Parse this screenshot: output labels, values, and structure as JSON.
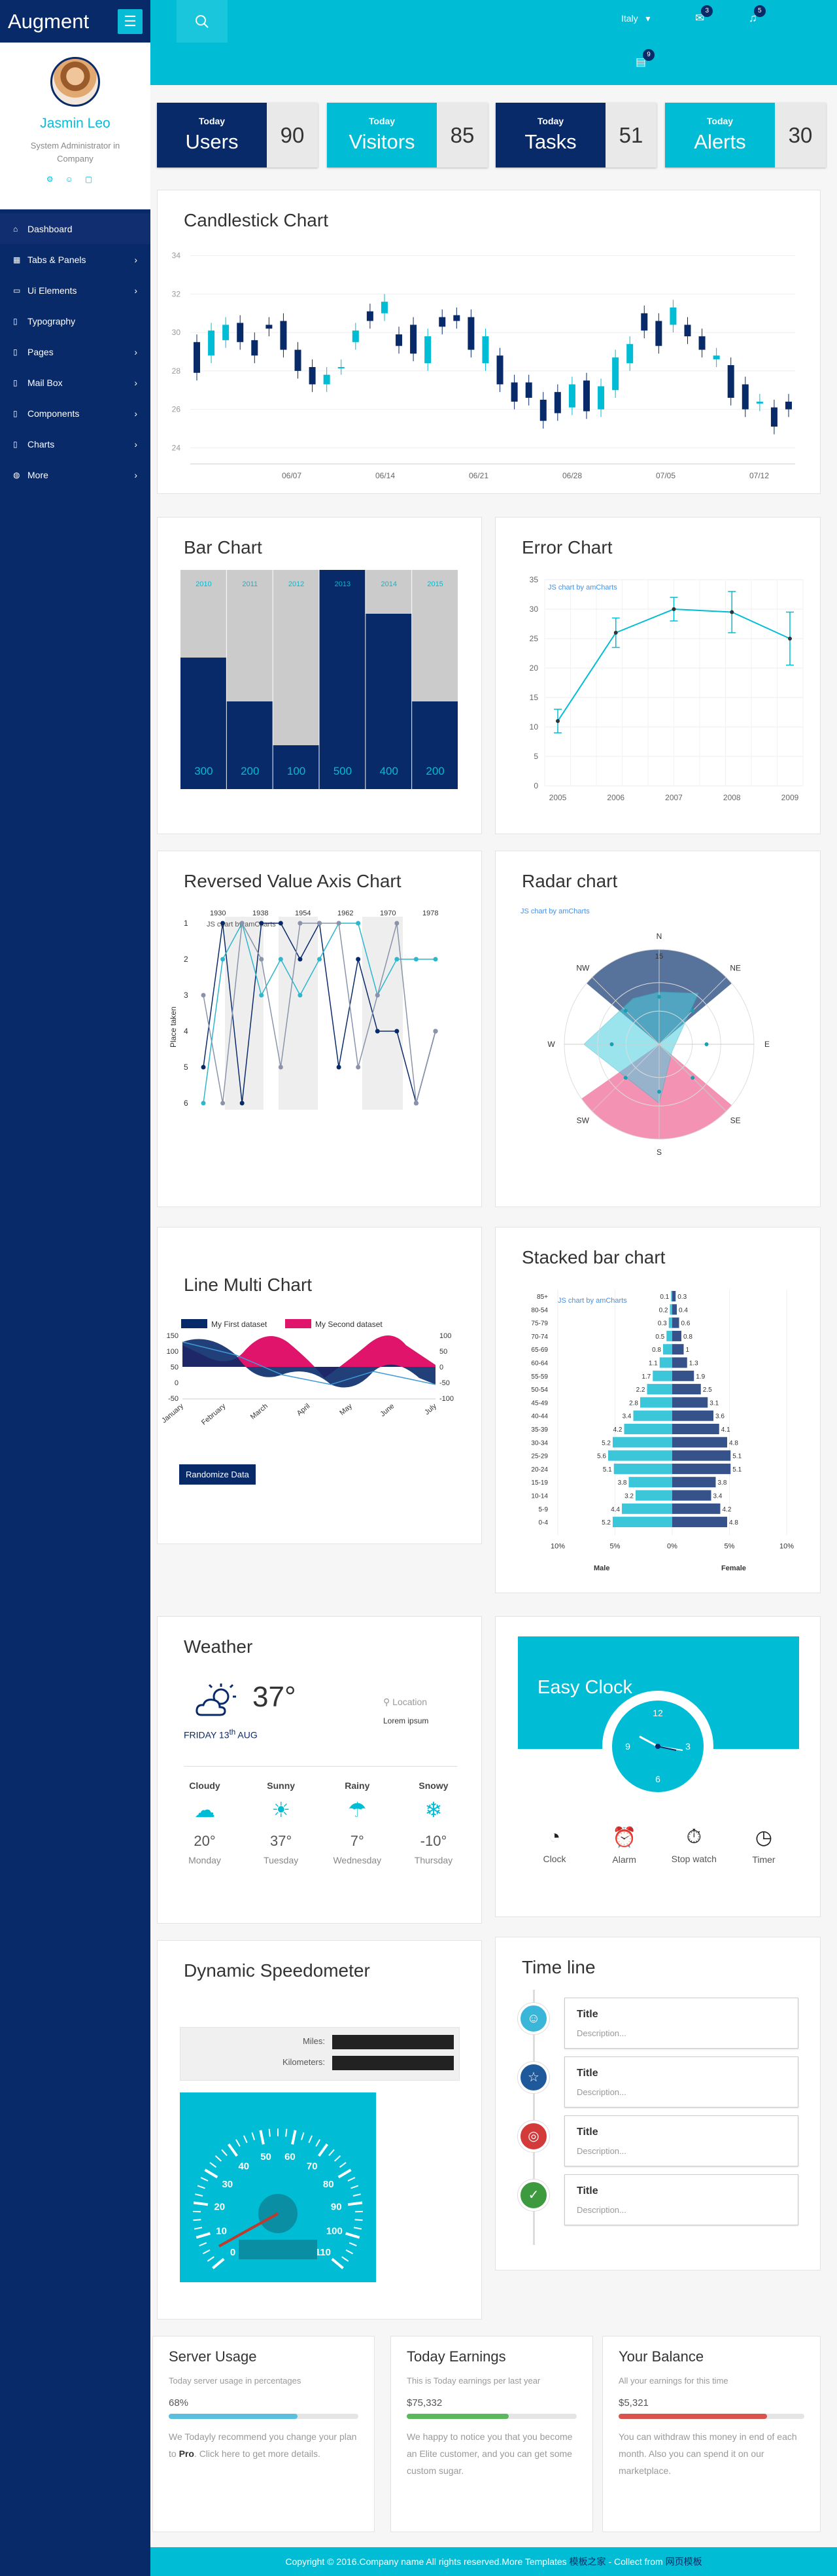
{
  "brand": "Augment",
  "profile": {
    "name": "Jasmin Leo",
    "role_line1": "System Administrator in",
    "role_line2": "Company"
  },
  "nav": [
    {
      "label": "Dashboard",
      "icon": "home-icon",
      "chevron": false
    },
    {
      "label": "Tabs & Panels",
      "icon": "table-icon",
      "chevron": true
    },
    {
      "label": "Ui Elements",
      "icon": "desktop-icon",
      "chevron": true
    },
    {
      "label": "Typography",
      "icon": "file-icon",
      "chevron": false
    },
    {
      "label": "Pages",
      "icon": "file-icon",
      "chevron": true
    },
    {
      "label": "Mail Box",
      "icon": "mail-icon",
      "chevron": true
    },
    {
      "label": "Components",
      "icon": "file-icon",
      "chevron": true
    },
    {
      "label": "Charts",
      "icon": "file-icon",
      "chevron": true
    },
    {
      "label": "More",
      "icon": "dots-icon",
      "chevron": true
    }
  ],
  "topbar": {
    "language": "Italy",
    "mail_count": "3",
    "bell_count": "5",
    "chat_count": "9"
  },
  "stats": [
    {
      "small": "Today",
      "label": "Users",
      "value": "90",
      "color": "#092a69"
    },
    {
      "small": "Today",
      "label": "Visitors",
      "value": "85",
      "color": "#00bcd4"
    },
    {
      "small": "Today",
      "label": "Tasks",
      "value": "51",
      "color": "#092a69"
    },
    {
      "small": "Today",
      "label": "Alerts",
      "value": "30",
      "color": "#00bcd4"
    }
  ],
  "candle": {
    "title": "Candlestick Chart",
    "chart_data": {
      "type": "candlestick",
      "y_ticks": [
        24,
        26,
        28,
        30,
        32,
        34
      ],
      "ylim": [
        23.5,
        34.5
      ],
      "x_labels": [
        "06/07",
        "06/14",
        "06/21",
        "06/28",
        "07/05",
        "07/12"
      ],
      "candles": [
        [
          29.5,
          27.9
        ],
        [
          28.8,
          30.1
        ],
        [
          29.6,
          30.4
        ],
        [
          30.5,
          29.5
        ],
        [
          29.6,
          28.8
        ],
        [
          30.4,
          30.2
        ],
        [
          30.6,
          29.1
        ],
        [
          29.1,
          28.0
        ],
        [
          28.2,
          27.3
        ],
        [
          27.3,
          27.8
        ],
        [
          28.2,
          28.2
        ],
        [
          29.5,
          30.1
        ],
        [
          31.1,
          30.6
        ],
        [
          31.0,
          31.6
        ],
        [
          29.9,
          29.3
        ],
        [
          30.4,
          28.9
        ],
        [
          28.4,
          29.8
        ],
        [
          30.8,
          30.3
        ],
        [
          30.9,
          30.6
        ],
        [
          30.8,
          29.1
        ],
        [
          28.4,
          29.8
        ],
        [
          28.8,
          27.3
        ],
        [
          27.4,
          26.4
        ],
        [
          27.4,
          26.6
        ],
        [
          26.5,
          25.4
        ],
        [
          26.9,
          25.8
        ],
        [
          26.1,
          27.3
        ],
        [
          27.5,
          25.9
        ],
        [
          26.0,
          27.2
        ],
        [
          27.0,
          28.7
        ],
        [
          28.4,
          29.4
        ],
        [
          31.0,
          30.1
        ],
        [
          30.6,
          29.3
        ],
        [
          30.4,
          31.3
        ],
        [
          30.4,
          29.8
        ],
        [
          29.8,
          29.1
        ],
        [
          28.6,
          28.8
        ],
        [
          28.3,
          26.6
        ],
        [
          27.3,
          26.0
        ],
        [
          26.3,
          26.4
        ],
        [
          26.1,
          25.1
        ],
        [
          26.4,
          26.0
        ]
      ]
    }
  },
  "bar": {
    "title": "Bar Chart",
    "chart_data": {
      "type": "bar",
      "categories": [
        "2010",
        "2011",
        "2012",
        "2013",
        "2014",
        "2015"
      ],
      "values": [
        300,
        200,
        100,
        500,
        400,
        200
      ],
      "ymax": 500
    }
  },
  "error": {
    "title": "Error Chart",
    "watermark": "JS chart by amCharts",
    "chart_data": {
      "type": "line",
      "x": [
        "2005",
        "2006",
        "2007",
        "2008",
        "2009"
      ],
      "values": [
        11,
        26,
        30,
        29.5,
        25
      ],
      "errors": [
        2,
        2.5,
        2,
        3.5,
        4.5
      ],
      "y_ticks": [
        0,
        5,
        10,
        15,
        20,
        25,
        30,
        35
      ]
    }
  },
  "reversed": {
    "title": "Reversed Value Axis Chart",
    "watermark": "JS chart by amCharts",
    "ylabel": "Place taken",
    "chart_data": {
      "type": "line",
      "top_labels": [
        "1930",
        "1938",
        "1954",
        "1962",
        "1970",
        "1978"
      ],
      "y_ticks": [
        1,
        2,
        3,
        4,
        5,
        6
      ],
      "series": [
        {
          "color": "#092a69",
          "values": [
            5,
            1,
            6,
            1,
            1,
            2,
            1,
            5,
            2,
            4,
            4,
            6,
            4
          ]
        },
        {
          "color": "#2cb7cc",
          "values": [
            6,
            2,
            1,
            3,
            2,
            3,
            2,
            1,
            1,
            3,
            2,
            2,
            2
          ]
        },
        {
          "color": "#8a93aa",
          "values": [
            3,
            6,
            1,
            2,
            5,
            1,
            1,
            1,
            5,
            3,
            1,
            6,
            4
          ]
        }
      ]
    }
  },
  "radar": {
    "title": "Radar chart",
    "watermark": "JS chart by amCharts",
    "chart_data": {
      "type": "radar",
      "axes": [
        "N",
        "NE",
        "E",
        "SE",
        "S",
        "SW",
        "W",
        "NW"
      ],
      "r_tick": "15"
    }
  },
  "linemulti": {
    "title": "Line Multi Chart",
    "legend": [
      "My First dataset",
      "My Second dataset"
    ],
    "left_ticks": [
      "150",
      "100",
      "50",
      "0",
      "-50"
    ],
    "right_ticks": [
      "100",
      "50",
      "0",
      "-50",
      "-100"
    ],
    "chart_data": {
      "type": "line",
      "x": [
        "January",
        "February",
        "March",
        "April",
        "May",
        "June",
        "July"
      ],
      "series": [
        {
          "name": "My First dataset",
          "color": "#092a69"
        },
        {
          "name": "My Second dataset",
          "color": "#e0146b"
        }
      ]
    },
    "button": "Randomize Data"
  },
  "stacked": {
    "title": "Stacked bar chart",
    "watermark": "JS chart by amCharts",
    "xlabel_left": "Male",
    "xlabel_right": "Female",
    "x_ticks": [
      "10%",
      "5%",
      "0%",
      "5%",
      "10%"
    ],
    "chart_data": {
      "type": "bar",
      "categories": [
        "85+",
        "80-54",
        "75-79",
        "70-74",
        "65-69",
        "60-64",
        "55-59",
        "50-54",
        "45-49",
        "40-44",
        "35-39",
        "30-34",
        "25-29",
        "20-24",
        "15-19",
        "10-14",
        "5-9",
        "0-4"
      ],
      "male": [
        0.1,
        0.2,
        0.3,
        0.5,
        0.8,
        1.1,
        1.7,
        2.2,
        2.8,
        3.4,
        4.2,
        5.2,
        5.6,
        5.1,
        3.8,
        3.2,
        4.4,
        5.2
      ],
      "female": [
        0.3,
        0.4,
        0.6,
        0.8,
        1.0,
        1.3,
        1.9,
        2.5,
        3.1,
        3.6,
        4.1,
        4.8,
        5.1,
        5.1,
        3.8,
        3.4,
        4.2,
        4.8
      ]
    }
  },
  "weather": {
    "title": "Weather",
    "temp": "37°",
    "date": "FRIDAY 13",
    "sup": "th",
    "month": "AUG",
    "location": "Location",
    "lorem": "Lorem ipsum",
    "days": [
      {
        "cond": "Cloudy",
        "icon": "cloud-icon",
        "temp": "20°",
        "day": "Monday"
      },
      {
        "cond": "Sunny",
        "icon": "sun-icon",
        "temp": "37°",
        "day": "Tuesday"
      },
      {
        "cond": "Rainy",
        "icon": "rain-icon",
        "temp": "7°",
        "day": "Wednesday"
      },
      {
        "cond": "Snowy",
        "icon": "snow-icon",
        "temp": "-10°",
        "day": "Thursday"
      }
    ]
  },
  "clock": {
    "title": "Easy Clock",
    "n12": "12",
    "n3": "3",
    "n6": "6",
    "n9": "9",
    "tabs": [
      "Clock",
      "Alarm",
      "Stop watch",
      "Timer"
    ]
  },
  "timeline": {
    "title": "Time line",
    "items": [
      {
        "title": "Title",
        "desc": "Description...",
        "color": "#3ab6d8",
        "icon": "smile-icon"
      },
      {
        "title": "Title",
        "desc": "Description...",
        "color": "#1e5a9b",
        "icon": "star-icon"
      },
      {
        "title": "Title",
        "desc": "Description...",
        "color": "#d33a3a",
        "icon": "target-icon"
      },
      {
        "title": "Title",
        "desc": "Description...",
        "color": "#3e9a3f",
        "icon": "check-icon"
      }
    ]
  },
  "speedo": {
    "title": "Dynamic Speedometer",
    "miles_label": "Miles:",
    "km_label": "Kilometers:",
    "ticks": [
      "0",
      "10",
      "20",
      "30",
      "40",
      "50",
      "60",
      "70",
      "80",
      "90",
      "100",
      "110"
    ]
  },
  "server": {
    "title": "Server Usage",
    "sub": "Today server usage in percentages",
    "value": "68%",
    "text_pre": "We Todayly recommend you change your plan to ",
    "text_bold": "Pro",
    "text_post": ". Click here to get more details.",
    "progress": 68
  },
  "earn": {
    "title": "Today Earnings",
    "sub": "This is Today earnings per last year",
    "value": "$75,332",
    "text": "We happy to notice you that you become an Elite customer, and you can get some custom sugar.",
    "progress": 60
  },
  "balance": {
    "title": "Your Balance",
    "sub": "All your earnings for this time",
    "value": "$5,321",
    "text": "You can withdraw this money in end of each month. Also you can spend it on our marketplace.",
    "progress": 80
  },
  "footer": {
    "text": "Copyright © 2016.Company name All rights reserved.More Templates ",
    "link1": "模板之家",
    "mid": " - Collect from ",
    "link2": "网页模板"
  }
}
